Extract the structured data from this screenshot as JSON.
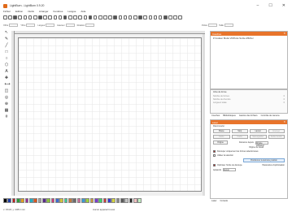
{
  "window": {
    "title": "LightBurn - LightBurn 0.9.20",
    "controls": [
      "–",
      "☐",
      "✕"
    ]
  },
  "menu": [
    "Fichier",
    "Edition",
    "Outils",
    "Arranger",
    "Fenêtres",
    "Langue",
    "Aide"
  ],
  "toolbar": {
    "icons": [
      "open-icon",
      "save-icon",
      "import-icon",
      "export-icon",
      "cut-icon",
      "copy-icon",
      "paste-icon",
      "undo-icon",
      "redo-icon",
      "zoom-in-icon",
      "zoom-out-icon",
      "zoom-fit-icon",
      "frame-icon",
      "pan-icon",
      "settings-icon",
      "camera-icon",
      "group-icon",
      "ungroup-icon",
      "align-left-icon",
      "align-center-icon",
      "align-right-icon",
      "align-top-icon",
      "align-middle-icon",
      "align-bottom-icon",
      "distribute-icon",
      "flip-h-icon",
      "flip-v-icon",
      "mirror-icon",
      "rotate-icon",
      "node-icon",
      "weld-icon",
      "boolean-icon",
      "offset-icon",
      "array-icon",
      "trace-icon",
      "measure-icon"
    ]
  },
  "propbar": {
    "fields": [
      {
        "label": "XPos",
        "value": ""
      },
      {
        "label": "YPos",
        "value": ""
      },
      {
        "label": "Largeur",
        "value": ""
      },
      {
        "label": "Hauteur",
        "value": ""
      },
      {
        "label": "Rotation",
        "value": ""
      }
    ],
    "right_fields": [
      {
        "label": "Police",
        "value": ""
      },
      {
        "label": "Taille",
        "value": ""
      }
    ]
  },
  "left_tools": [
    "select-icon",
    "edit-nodes-icon",
    "line-icon",
    "rectangle-icon",
    "ellipse-icon",
    "polygon-icon",
    "text-icon",
    "position-icon",
    "measure-icon",
    "tab-icon",
    "offset-icon",
    "weld-icon",
    "array-icon",
    "grid-icon"
  ],
  "palette": [
    "#000000",
    "#1f3fa8",
    "#c41e1e",
    "#2e9e3b",
    "#e0a020",
    "#9c2aa0",
    "#1fb0c4",
    "#e0551c",
    "#a0a0a0",
    "#5a2a8c",
    "#8cc43a",
    "#d43a7a",
    "#3a6ed4",
    "#d4c43a",
    "#3ad49c",
    "#c47a3a",
    "#6a6a6a",
    "#d46a9c",
    "#3a9cd4",
    "#9cd43a",
    "#d49c3a",
    "#7a3ad4",
    "#3ad46a",
    "#d43a3a",
    "#3a3ad4",
    "#d4d43a",
    "#8a8a8a",
    "#5a5a5a",
    "#c4c4c4",
    "#2a2a2a",
    "#f0c0c0",
    "#c0f0c0"
  ],
  "status": {
    "coords": "x: 154.8, y: 238.4 mm",
    "message": "Aucun appareil trouvé"
  },
  "layers_panel": {
    "title": "Couches",
    "columns": [
      "#",
      "Couleur",
      "Mode",
      "Vit/Puiss",
      "Sortie",
      "Afficher"
    ],
    "header_line": "#  Couleur  Mode  Vit/Puiss  Sortie  Afficher"
  },
  "geometry": {
    "title": "Infos de forme",
    "rows": [
      {
        "label": "Nombre de formes",
        "value": "0"
      },
      {
        "label": "Nombre de chemins",
        "value": "0"
      },
      {
        "label": "Longueur totale",
        "value": "0"
      }
    ]
  },
  "bottom_tabs": [
    "Couches",
    "Bibliothèques",
    "Gestion des fichiers",
    "Contrôle de camera"
  ],
  "laser_panel": {
    "title": "Laser",
    "subtitle": "Déconnecté",
    "row1": [
      "Pause",
      "Stop",
      "Lancer",
      "Envoyer"
    ],
    "row2": [
      "Cadre",
      "Cadre",
      "Sauvegarder",
      "Sortie Gcode"
    ],
    "home_label": "Origine",
    "start_label": "Démarrer depuis",
    "start_value": "Origine utilisateur",
    "job_origin_label": "Origine du travail",
    "options": [
      {
        "label": "Découper uniquement les formes sélectionnées",
        "checked": true
      },
      {
        "label": "Utiliser la sélection",
        "checked": false
      },
      {
        "label": "Optimiser l'ordre de découpe",
        "checked": true
      }
    ],
    "show_last": "Positionner la dernière position",
    "optimize_settings": "Paramètres d'optimisation",
    "device_label": "Appareils",
    "device_value": "Aucun"
  },
  "panel_footer": [
    "Laser",
    "Console"
  ]
}
